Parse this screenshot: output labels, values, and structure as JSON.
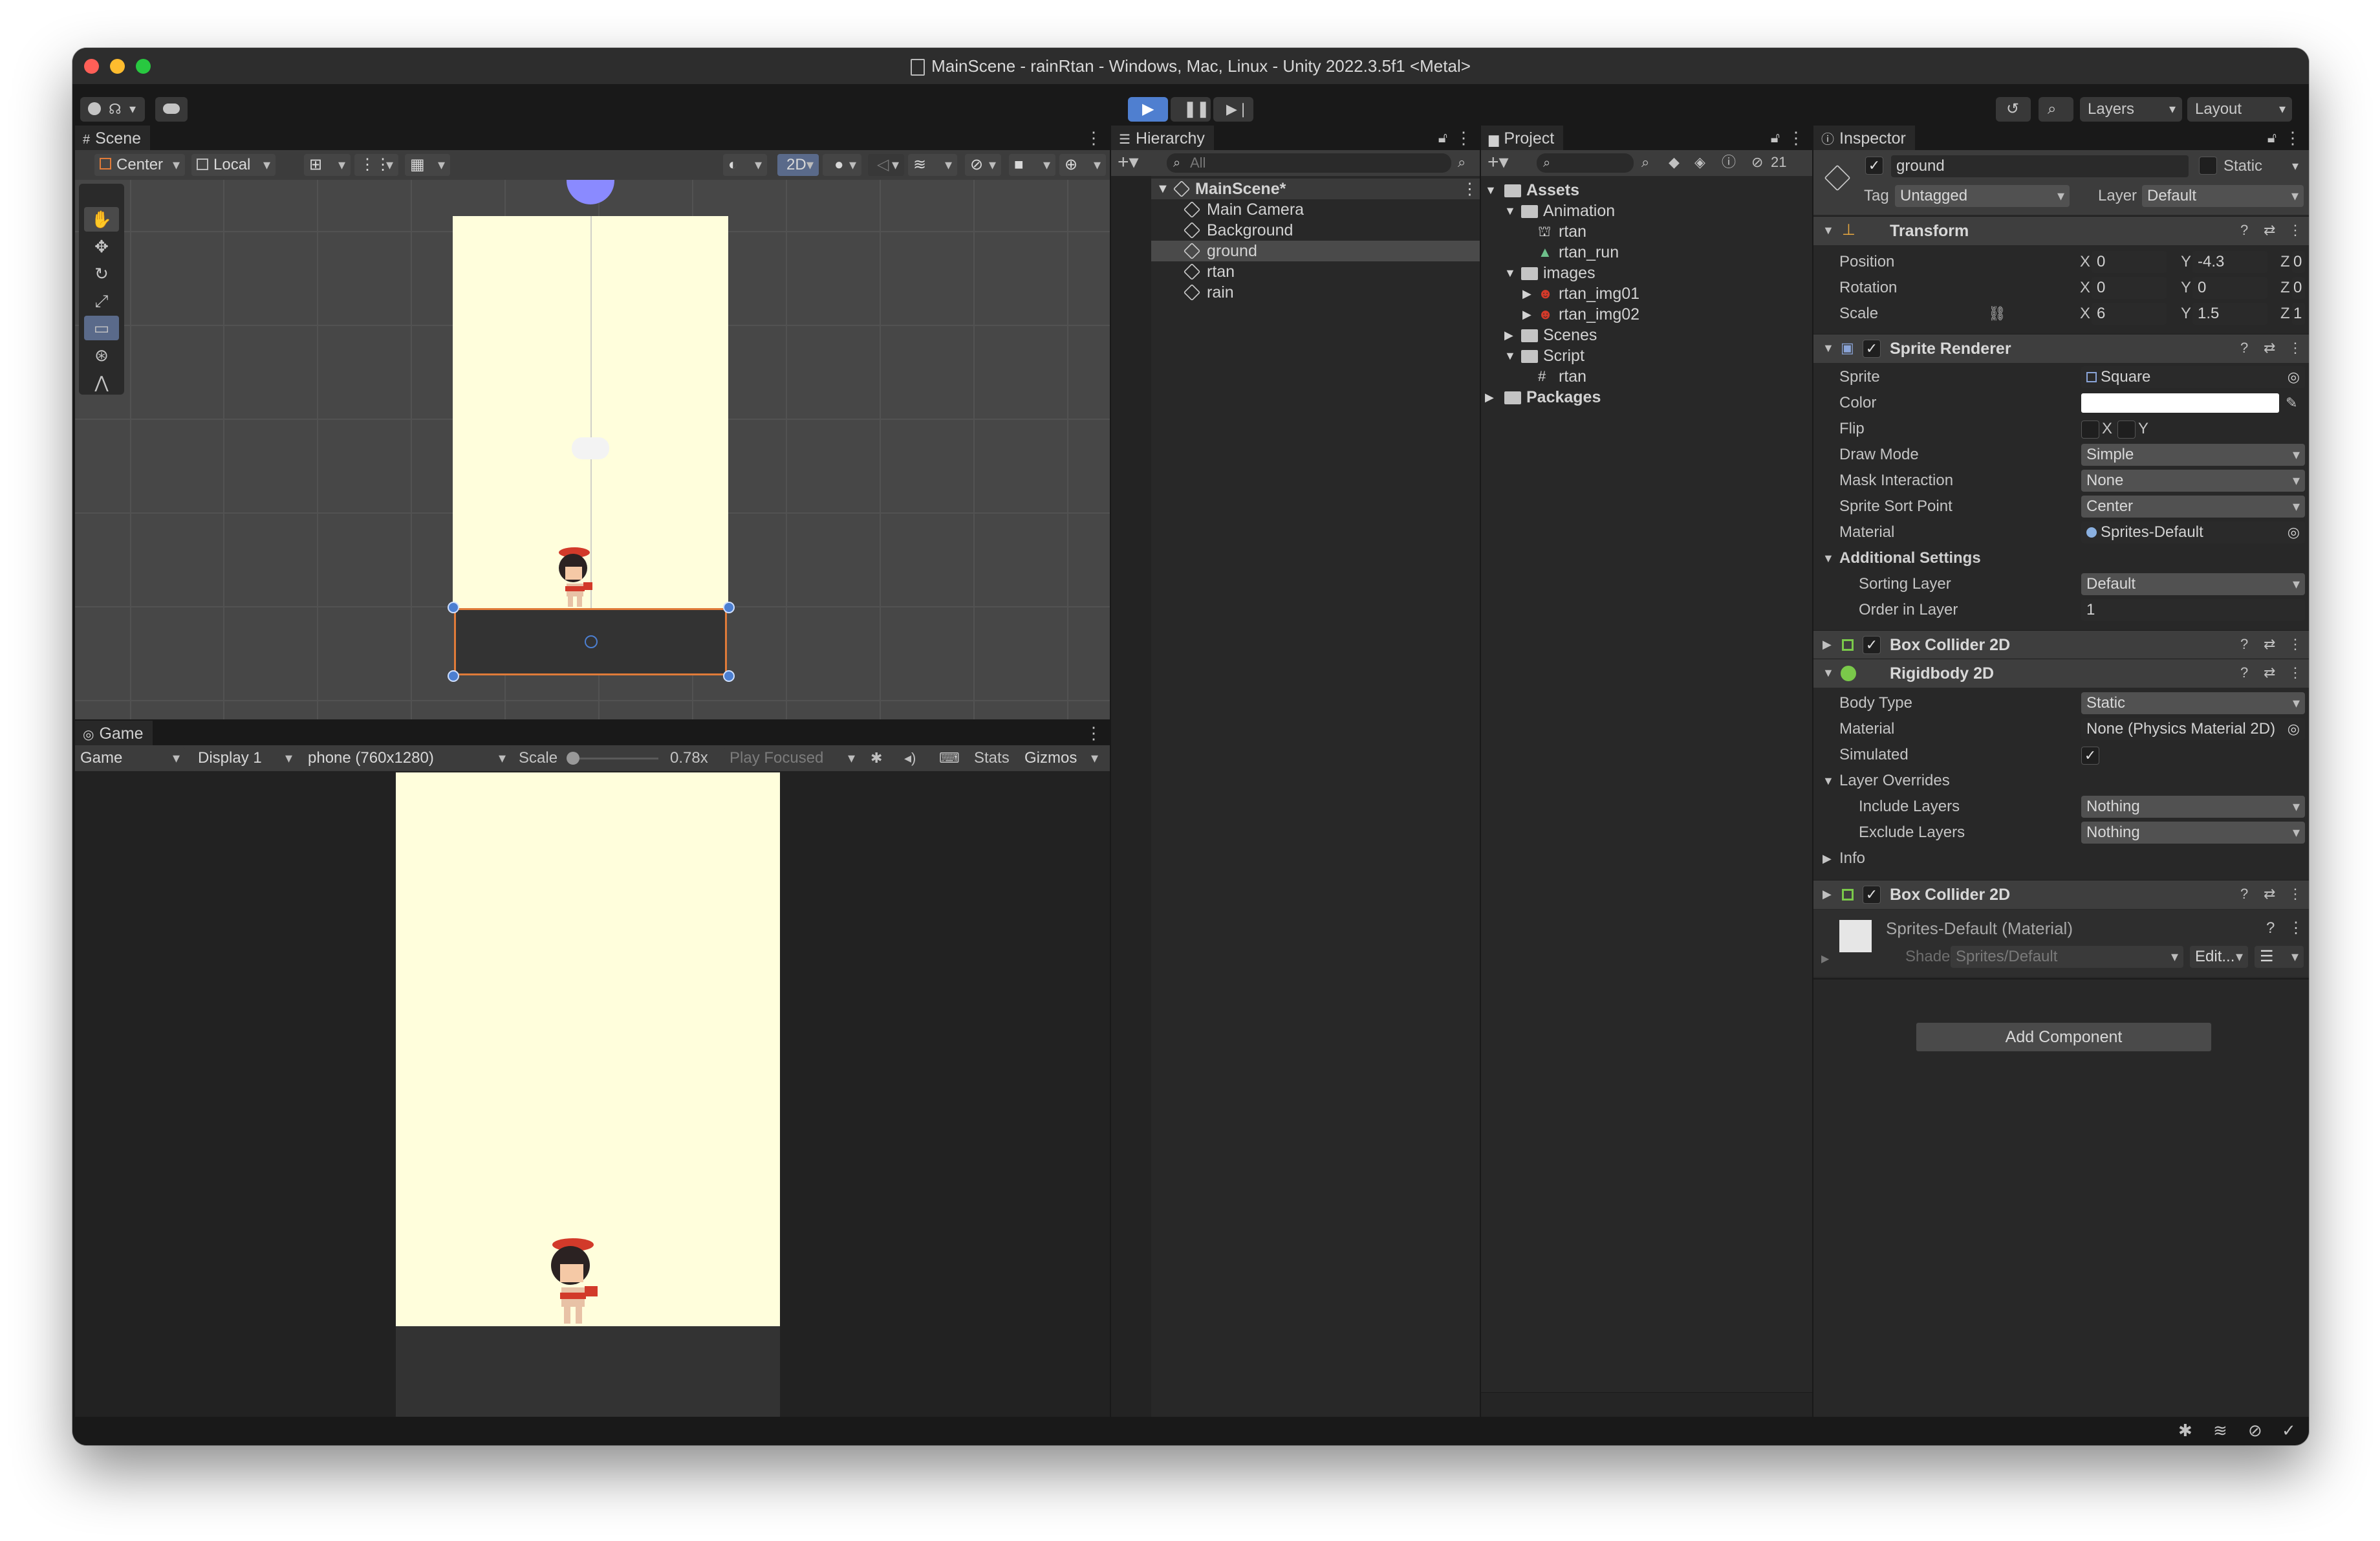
{
  "window": {
    "title": "MainScene - rainRtan - Windows, Mac, Linux - Unity 2022.3.5f1 <Metal>"
  },
  "toolbar": {
    "layers_label": "Layers",
    "layout_label": "Layout"
  },
  "scene": {
    "tab_label": "Scene",
    "pivot_label": "Center",
    "space_label": "Local",
    "mode_2d": "2D"
  },
  "game": {
    "tab_label": "Game",
    "view_select": "Game",
    "display_select": "Display 1",
    "resolution_select": "phone (760x1280)",
    "scale_label": "Scale",
    "scale_value": "0.78x",
    "play_mode": "Play Focused",
    "stats_label": "Stats",
    "gizmos_label": "Gizmos"
  },
  "hierarchy": {
    "tab_label": "Hierarchy",
    "search_placeholder": "All",
    "scene_name": "MainScene*",
    "items": [
      {
        "label": "Main Camera"
      },
      {
        "label": "Background"
      },
      {
        "label": "ground"
      },
      {
        "label": "rtan"
      },
      {
        "label": "rain"
      }
    ]
  },
  "project": {
    "tab_label": "Project",
    "hidden_count": "21",
    "assets_label": "Assets",
    "animation_label": "Animation",
    "anim_items": [
      "rtan",
      "rtan_run"
    ],
    "images_label": "images",
    "image_items": [
      "rtan_img01",
      "rtan_img02"
    ],
    "scenes_label": "Scenes",
    "script_label": "Script",
    "script_items": [
      "rtan"
    ],
    "packages_label": "Packages"
  },
  "inspector": {
    "tab_label": "Inspector",
    "object_name": "ground",
    "static_label": "Static",
    "tag_label": "Tag",
    "tag_value": "Untagged",
    "layer_label": "Layer",
    "layer_value": "Default",
    "transform": {
      "title": "Transform",
      "position_label": "Position",
      "rotation_label": "Rotation",
      "scale_label": "Scale",
      "position": {
        "x": "0",
        "y": "-4.3",
        "z": "0"
      },
      "rotation": {
        "x": "0",
        "y": "0",
        "z": "0"
      },
      "scale": {
        "x": "6",
        "y": "1.5",
        "z": "1"
      },
      "axis_x": "X",
      "axis_y": "Y",
      "axis_z": "Z"
    },
    "sprite_renderer": {
      "title": "Sprite Renderer",
      "sprite_label": "Sprite",
      "sprite_value": "Square",
      "color_label": "Color",
      "flip_label": "Flip",
      "flip_x": "X",
      "flip_y": "Y",
      "draw_mode_label": "Draw Mode",
      "draw_mode_value": "Simple",
      "mask_label": "Mask Interaction",
      "mask_value": "None",
      "sort_point_label": "Sprite Sort Point",
      "sort_point_value": "Center",
      "material_label": "Material",
      "material_value": "Sprites-Default",
      "additional_label": "Additional Settings",
      "sorting_layer_label": "Sorting Layer",
      "sorting_layer_value": "Default",
      "order_label": "Order in Layer",
      "order_value": "1"
    },
    "box_collider_title": "Box Collider 2D",
    "rigidbody": {
      "title": "Rigidbody 2D",
      "body_type_label": "Body Type",
      "body_type_value": "Static",
      "material_label": "Material",
      "material_value": "None (Physics Material 2D)",
      "simulated_label": "Simulated",
      "overrides_label": "Layer Overrides",
      "include_label": "Include Layers",
      "include_value": "Nothing",
      "exclude_label": "Exclude Layers",
      "exclude_value": "Nothing",
      "info_label": "Info"
    },
    "box_collider2_title": "Box Collider 2D",
    "material_block": {
      "name": "Sprites-Default (Material)",
      "shader_label": "Shader",
      "shader_value": "Sprites/Default",
      "edit_label": "Edit..."
    },
    "add_component_label": "Add Component"
  },
  "colors": {
    "background": "#fffedc",
    "selection": "#e07b39",
    "accent_blue": "#4c7fd1"
  }
}
